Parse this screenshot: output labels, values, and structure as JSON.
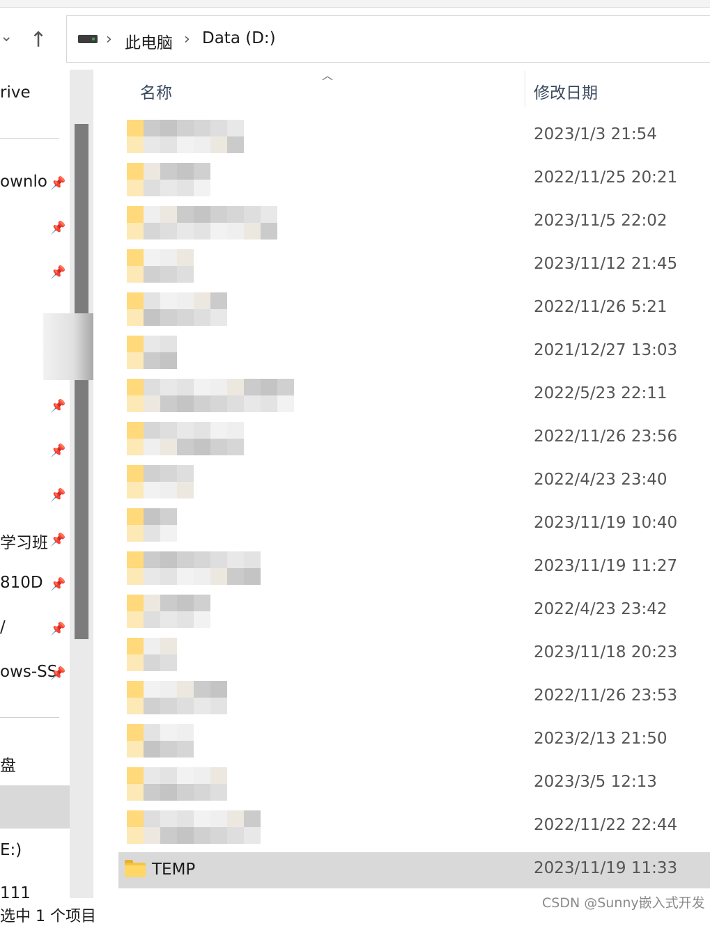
{
  "breadcrumb": {
    "items": [
      "此电脑",
      "Data (D:)"
    ]
  },
  "sidebar": {
    "items": [
      {
        "label": "rive",
        "pinned": false
      },
      {
        "label": "ownlo",
        "pinned": true
      },
      {
        "label": "",
        "pinned": true
      },
      {
        "label": "",
        "pinned": true
      },
      {
        "label": "",
        "pinned": true
      },
      {
        "label": "",
        "pinned": true
      },
      {
        "label": "",
        "pinned": true
      },
      {
        "label": "学习班",
        "pinned": true
      },
      {
        "label": "810D",
        "pinned": true
      },
      {
        "label": "/",
        "pinned": true
      },
      {
        "label": "ows-SS",
        "pinned": true
      },
      {
        "label": "盘",
        "pinned": false
      },
      {
        "label": "E:)",
        "pinned": false
      },
      {
        "label": "111",
        "pinned": false
      }
    ]
  },
  "columns": {
    "name": "名称",
    "modified": "修改日期"
  },
  "files": [
    {
      "name": "",
      "date": "2023/1/3 21:54",
      "selected": false
    },
    {
      "name": "",
      "date": "2022/11/25 20:21",
      "selected": false
    },
    {
      "name": "",
      "date": "2023/11/5 22:02",
      "selected": false
    },
    {
      "name": "",
      "date": "2023/11/12 21:45",
      "selected": false
    },
    {
      "name": "",
      "date": "2022/11/26 5:21",
      "selected": false
    },
    {
      "name": "",
      "date": "2021/12/27 13:03",
      "selected": false
    },
    {
      "name": "",
      "date": "2022/5/23 22:11",
      "selected": false
    },
    {
      "name": "",
      "date": "2022/11/26 23:56",
      "selected": false
    },
    {
      "name": "",
      "date": "2022/4/23 23:40",
      "selected": false
    },
    {
      "name": "",
      "date": "2023/11/19 10:40",
      "selected": false
    },
    {
      "name": "",
      "date": "2023/11/19 11:27",
      "selected": false
    },
    {
      "name": "",
      "date": "2022/4/23 23:42",
      "selected": false
    },
    {
      "name": "",
      "date": "2023/11/18 20:23",
      "selected": false
    },
    {
      "name": "",
      "date": "2022/11/26 23:53",
      "selected": false
    },
    {
      "name": "",
      "date": "2023/2/13 21:50",
      "selected": false
    },
    {
      "name": "",
      "date": "2023/3/5 12:13",
      "selected": false
    },
    {
      "name": "",
      "date": "2022/11/22 22:44",
      "selected": false
    },
    {
      "name": "TEMP",
      "date": "2023/11/19 11:33",
      "selected": true
    }
  ],
  "statusbar": {
    "text": "选中 1 个项目"
  },
  "watermark": "CSDN @Sunny嵌入式开发",
  "colors": {
    "folder": "#ffd766",
    "selection": "#d9d9d9",
    "scrollbar": "#7c7c7c"
  }
}
